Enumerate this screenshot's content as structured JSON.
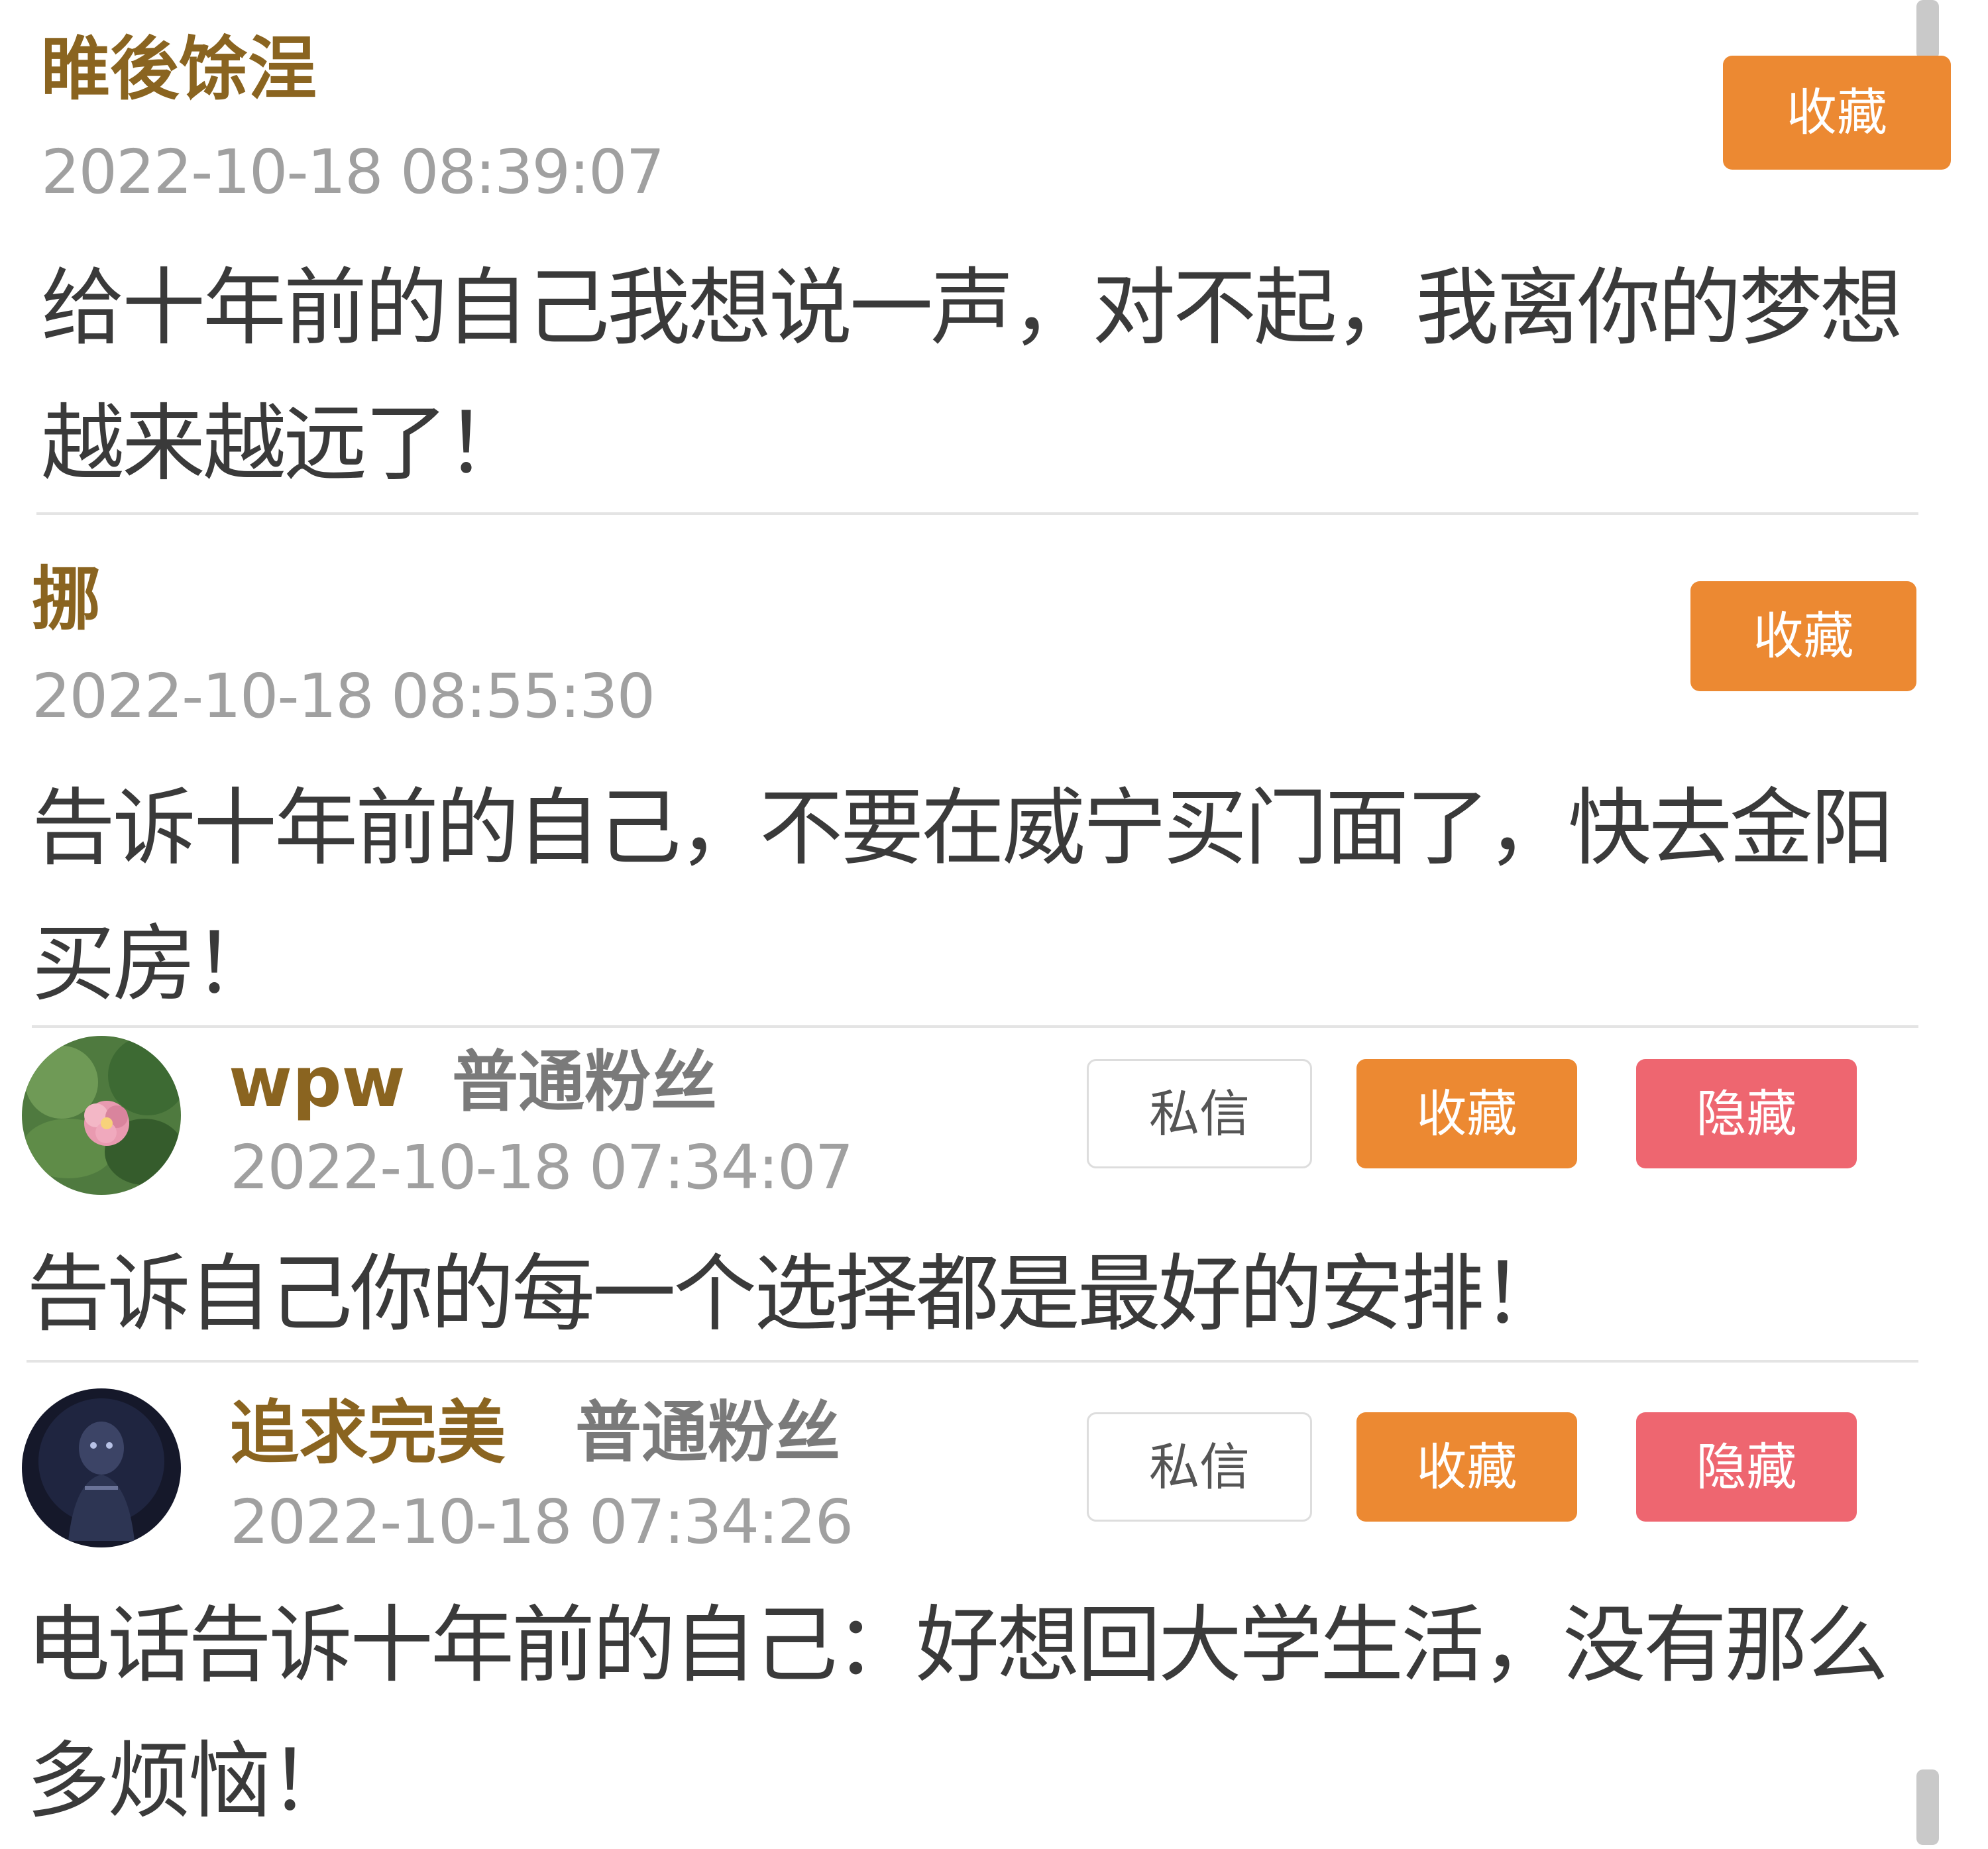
{
  "comments": [
    {
      "username": "睢後馀浧",
      "timestamp": "2022-10-18 08:39:07",
      "text": "给十年前的自己我想说一声，对不起，我离你的梦想越来越远了！",
      "buttons": {
        "favorite": "收藏"
      }
    },
    {
      "username": "挪",
      "timestamp": "2022-10-18 08:55:30",
      "text": "告诉十年前的自己，不要在威宁买门面了，快去金阳买房！",
      "buttons": {
        "favorite": "收藏"
      }
    },
    {
      "username": "wpw",
      "fan_level": "普通粉丝",
      "timestamp": "2022-10-18 07:34:07",
      "text": "告诉自己你的每一个选择都是最好的安排！",
      "buttons": {
        "message": "私信",
        "favorite": "收藏",
        "hide": "隐藏"
      }
    },
    {
      "username": "追求完美",
      "fan_level": "普通粉丝",
      "timestamp": "2022-10-18 07:34:26",
      "text": "电话告诉十年前的自己：好想回大学生活，没有那么多烦恼！",
      "buttons": {
        "message": "私信",
        "favorite": "收藏",
        "hide": "隐藏"
      }
    }
  ],
  "colors": {
    "username": "#8a6420",
    "favorite_button": "#ec8932",
    "hide_button": "#ee6670",
    "timestamp": "#a0a0a0"
  },
  "icons": [
    "flower-avatar-icon",
    "dark-figure-avatar-icon"
  ]
}
